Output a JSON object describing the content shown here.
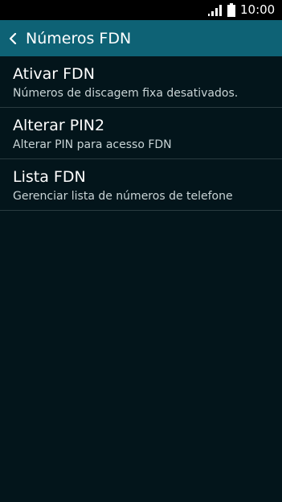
{
  "status_bar": {
    "time": "10:00",
    "signal_icon": "signal-icon",
    "battery_icon": "battery-icon"
  },
  "action_bar": {
    "title": "Números FDN",
    "back_icon": "back-icon",
    "color": "#0e6275"
  },
  "settings": [
    {
      "title": "Ativar FDN",
      "summary": "Números de discagem fixa desativados."
    },
    {
      "title": "Alterar PIN2",
      "summary": "Alterar PIN para acesso FDN"
    },
    {
      "title": "Lista FDN",
      "summary": "Gerenciar lista de números de telefone"
    }
  ],
  "colors": {
    "background": "#03151b",
    "status_bar": "#000000",
    "divider": "#2a3b40"
  }
}
